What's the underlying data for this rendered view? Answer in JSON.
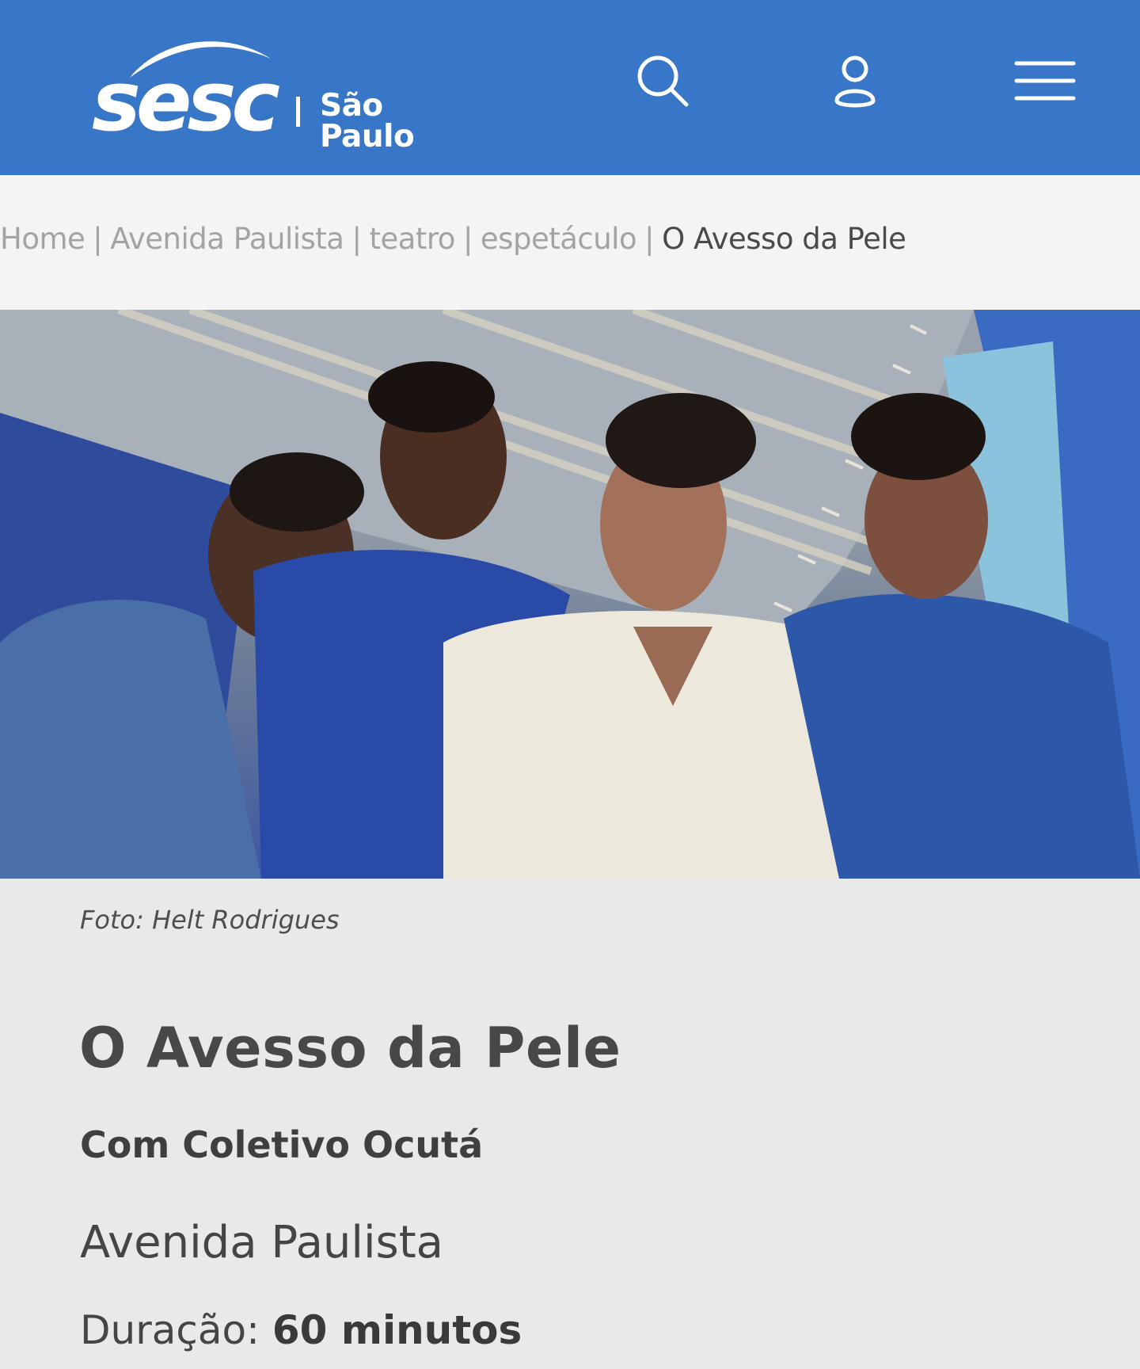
{
  "header": {
    "brand": "sesc",
    "city": "São Paulo",
    "bg_color": "#3877c8",
    "icons": {
      "search": "search-icon",
      "user": "user-icon",
      "menu": "menu-icon"
    }
  },
  "breadcrumb": {
    "items": [
      "Home",
      "Avenida Paulista",
      "teatro",
      "espetáculo"
    ],
    "separator": "|",
    "current": "O Avesso da Pele"
  },
  "hero": {
    "caption": "Foto: Helt Rodrigues"
  },
  "event": {
    "title": "O Avesso da Pele",
    "subtitle": "Com Coletivo Ocutá",
    "venue": "Avenida Paulista",
    "duration_label": "Duração:",
    "duration_value": "60 minutos"
  }
}
